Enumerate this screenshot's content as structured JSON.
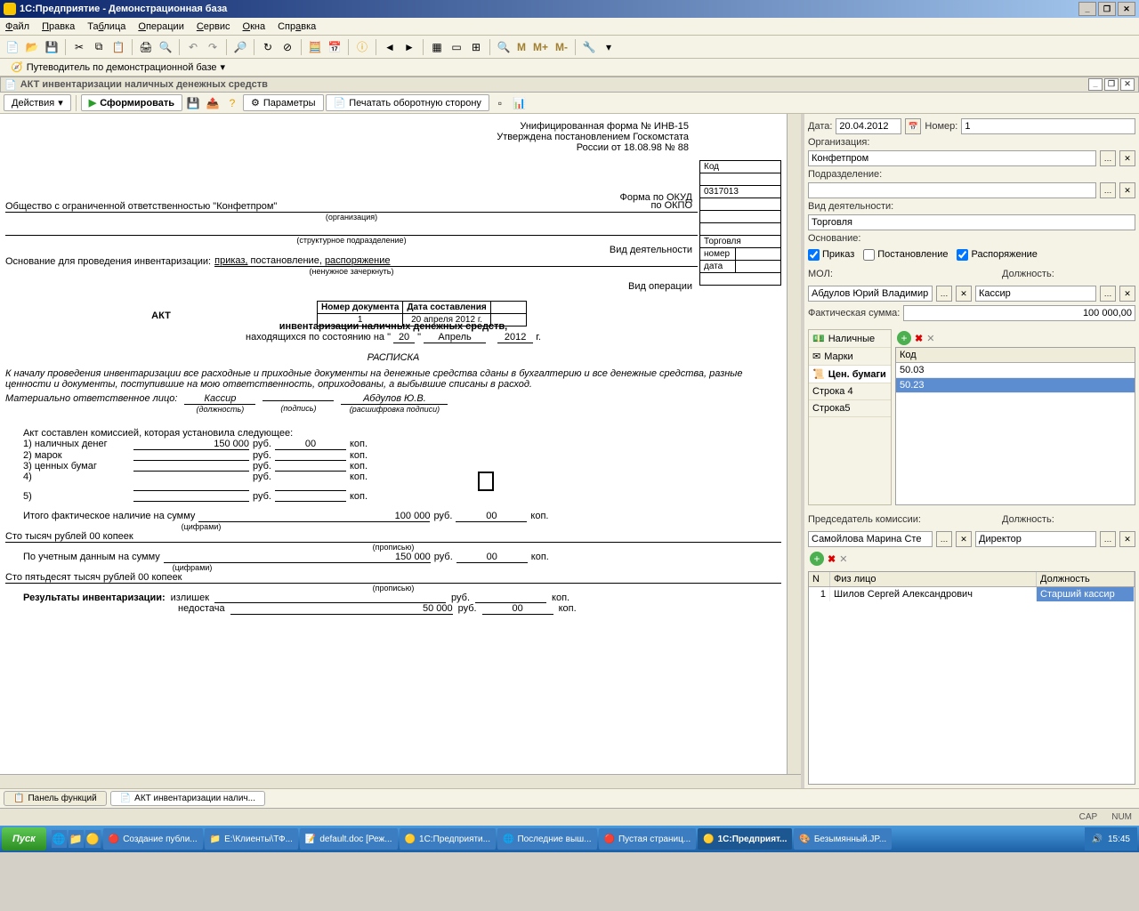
{
  "window_title": "1С:Предприятие - Демонстрационная база",
  "menu": [
    "Файл",
    "Правка",
    "Таблица",
    "Операции",
    "Сервис",
    "Окна",
    "Справка"
  ],
  "guide_link": "Путеводитель по демонстрационной базе",
  "doc_window_title": "АКТ инвентаризации наличных денежных средств",
  "doc_toolbar": {
    "actions": "Действия",
    "form": "Сформировать",
    "params": "Параметры",
    "print_back": "Печатать оборотную сторону"
  },
  "doc": {
    "form_header1": "Унифицированная форма № ИНВ-15",
    "form_header2": "Утверждена постановлением Госкомстата",
    "form_header3": "России от 18.08.98 № 88",
    "kod_label": "Код",
    "okud_label": "Форма по ОКУД",
    "okud": "0317013",
    "okpo_label": "по ОКПО",
    "org": "Общество с ограниченной ответственностью \"Конфетпром\"",
    "org_hint": "(организация)",
    "subdiv_hint": "(структурное подразделение)",
    "activity_label": "Вид деятельности",
    "activity": "Торговля",
    "basis_label": "Основание для проведения инвентаризации:",
    "basis_opts": "приказ, постановление, распоряжение",
    "basis_hint": "(ненужное зачеркнуть)",
    "num_label": "номер",
    "date_label": "дата",
    "optype_label": "Вид операции",
    "docnum_label": "Номер документа",
    "docdate_label": "Дата составления",
    "docnum": "1",
    "docdate": "20 апреля 2012 г.",
    "akt": "АКТ",
    "akt_sub": "инвентаризации наличных денежных средств,",
    "asof": "находящихся по состоянию на   \"",
    "asof_day": "20",
    "asof_quote": "\"",
    "asof_month": "Апрель",
    "asof_year": "2012",
    "asof_g": "г.",
    "receipt": "РАСПИСКА",
    "receipt_text": "К началу проведения инвентаризации все расходные и приходные документы на денежные средства сданы в бухгалтерию и все денежные средства, разные ценности и документы, поступившие на мою ответственность, оприходованы, а выбывшие списаны в расход.",
    "mol_label": "Материально ответственное лицо:",
    "mol_pos": "Кассир",
    "mol_pos_hint": "(должность)",
    "sign_hint": "(подпись)",
    "mol_name": "Абдулов Ю.В.",
    "name_hint": "(расшифровка подписи)",
    "comm_intro": "Акт составлен комиссией, которая установила следующее:",
    "r1": "1) наличных денег",
    "r1v": "150 000",
    "rub": "руб.",
    "r1k": "00",
    "kop": "коп.",
    "r2": "2) марок",
    "r3": "3) ценных бумаг",
    "r4": "4)",
    "r5": "5)",
    "total_label": "Итого фактическое наличие на сумму",
    "total_v": "100 000",
    "total_k": "00",
    "tsifr": "(цифрами)",
    "words1": "Сто тысяч рублей 00 копеек",
    "prop": "(прописью)",
    "uchet_label": "По учетным данным на сумму",
    "uchet_v": "150 000",
    "uchet_k": "00",
    "words2": "Сто пятьдесят тысяч рублей 00 копеек",
    "results": "Результаты инвентаризации:",
    "surplus": "излишек",
    "shortage": "недостача",
    "short_v": "50 000",
    "short_k": "00"
  },
  "side": {
    "date_lbl": "Дата:",
    "date": "20.04.2012",
    "num_lbl": "Номер:",
    "num": "1",
    "org_lbl": "Организация:",
    "org": "Конфетпром",
    "subdiv_lbl": "Подразделение:",
    "subdiv": "",
    "activity_lbl": "Вид деятельности:",
    "activity": "Торговля",
    "basis_lbl": "Основание:",
    "cb_prikaz": "Приказ",
    "cb_post": "Постановление",
    "cb_rasp": "Распоряжение",
    "mol_lbl": "МОЛ:",
    "mol": "Абдулов Юрий Владимир",
    "pos_lbl": "Должность:",
    "pos": "Кассир",
    "fact_lbl": "Фактическая сумма:",
    "fact": "100 000,00",
    "cats": [
      "Наличные",
      "Марки",
      "Цен. бумаги",
      "Строка 4",
      "Строка5"
    ],
    "kod_hdr": "Код",
    "codes": [
      "50.03",
      "50.23"
    ],
    "chair_lbl": "Председатель комиссии:",
    "chair_pos_lbl": "Должность:",
    "chair": "Самойлова Марина Сте",
    "chair_pos": "Директор",
    "ct_n": "N",
    "ct_fio": "Физ лицо",
    "ct_pos": "Должность",
    "member_n": "1",
    "member_fio": "Шилов Сергей Александрович",
    "member_pos": "Старший кассир"
  },
  "wtabs": {
    "panel": "Панель функций",
    "akt": "АКТ инвентаризации налич..."
  },
  "status": {
    "cap": "CAP",
    "num": "NUM"
  },
  "taskbar": {
    "start": "Пуск",
    "items": [
      "Создание публи...",
      "E:\\Клиенты\\ТФ...",
      "default.doc [Реж...",
      "1С:Предприяти...",
      "Последние выш...",
      "Пустая страниц...",
      "1С:Предприят...",
      "Безымянный.JP..."
    ],
    "time": "15:45"
  }
}
